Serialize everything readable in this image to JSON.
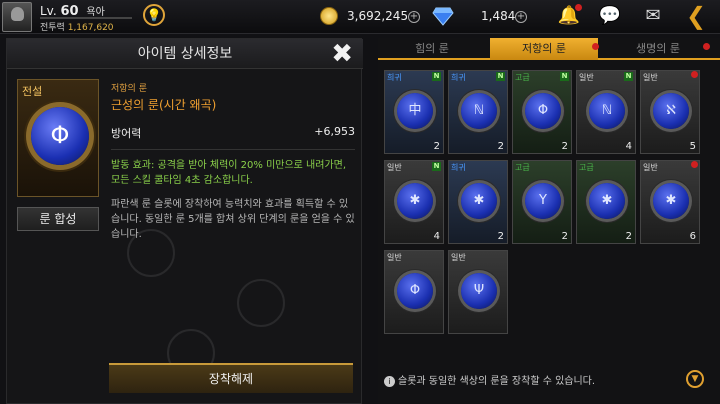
{
  "player": {
    "level_prefix": "Lv.",
    "level": "60",
    "name": "욕아",
    "cp_label": "전투력",
    "cp_value": "1,167,620"
  },
  "currency": {
    "gold": "3,692,245",
    "diamond": "1,484"
  },
  "detail": {
    "title": "아이템 상세정보",
    "grade": "전설",
    "synth_label": "룬 합성",
    "category": "저항의 룬",
    "item_name": "근성의 룬(시간 왜곡)",
    "stat_name": "방어력",
    "stat_value": "+6,953",
    "effect": "발동 효과: 공격을 받아 체력이 20% 미만으로 내려가면, 모든 스킬 쿨타임 4초 감소합니다.",
    "description": "파란색 룬 슬롯에 장착하여 능력치와 효과를 획득할 수 있습니다. 동일한 룬 5개를 합쳐 상위 단계의 룬을 얻을 수 있습니다.",
    "unequip_label": "장착해제"
  },
  "tabs": [
    {
      "label": "힘의 룬",
      "active": false
    },
    {
      "label": "저항의 룬",
      "active": true
    },
    {
      "label": "생명의 룬",
      "active": false
    }
  ],
  "runes": [
    {
      "grade": "희귀",
      "symbol": "中",
      "count": "2",
      "new": "N"
    },
    {
      "grade": "희귀",
      "symbol": "ℕ",
      "count": "2",
      "new": "N"
    },
    {
      "grade": "고급",
      "symbol": "Φ",
      "count": "2",
      "new": "N"
    },
    {
      "grade": "일반",
      "symbol": "ℕ",
      "count": "4",
      "new": "N"
    },
    {
      "grade": "일반",
      "symbol": "ℵ",
      "count": "5",
      "new": ""
    },
    {
      "grade": "일반",
      "symbol": "✱",
      "count": "4",
      "new": "N"
    },
    {
      "grade": "희귀",
      "symbol": "✱",
      "count": "2",
      "new": ""
    },
    {
      "grade": "고급",
      "symbol": "Y",
      "count": "2",
      "new": ""
    },
    {
      "grade": "고급",
      "symbol": "✱",
      "count": "2",
      "new": ""
    },
    {
      "grade": "일반",
      "symbol": "✱",
      "count": "6",
      "new": ""
    },
    {
      "grade": "일반",
      "symbol": "Φ",
      "count": "",
      "new": ""
    },
    {
      "grade": "일반",
      "symbol": "Ψ",
      "count": "",
      "new": ""
    }
  ],
  "hint": "슬롯과 동일한 색상의 룬을 장착할 수 있습니다.",
  "colors": {
    "accent": "#e0a020",
    "legend": "#f0c060",
    "rare": "#4a9aff",
    "advanced": "#4ab84a",
    "normal": "#dddddd"
  }
}
